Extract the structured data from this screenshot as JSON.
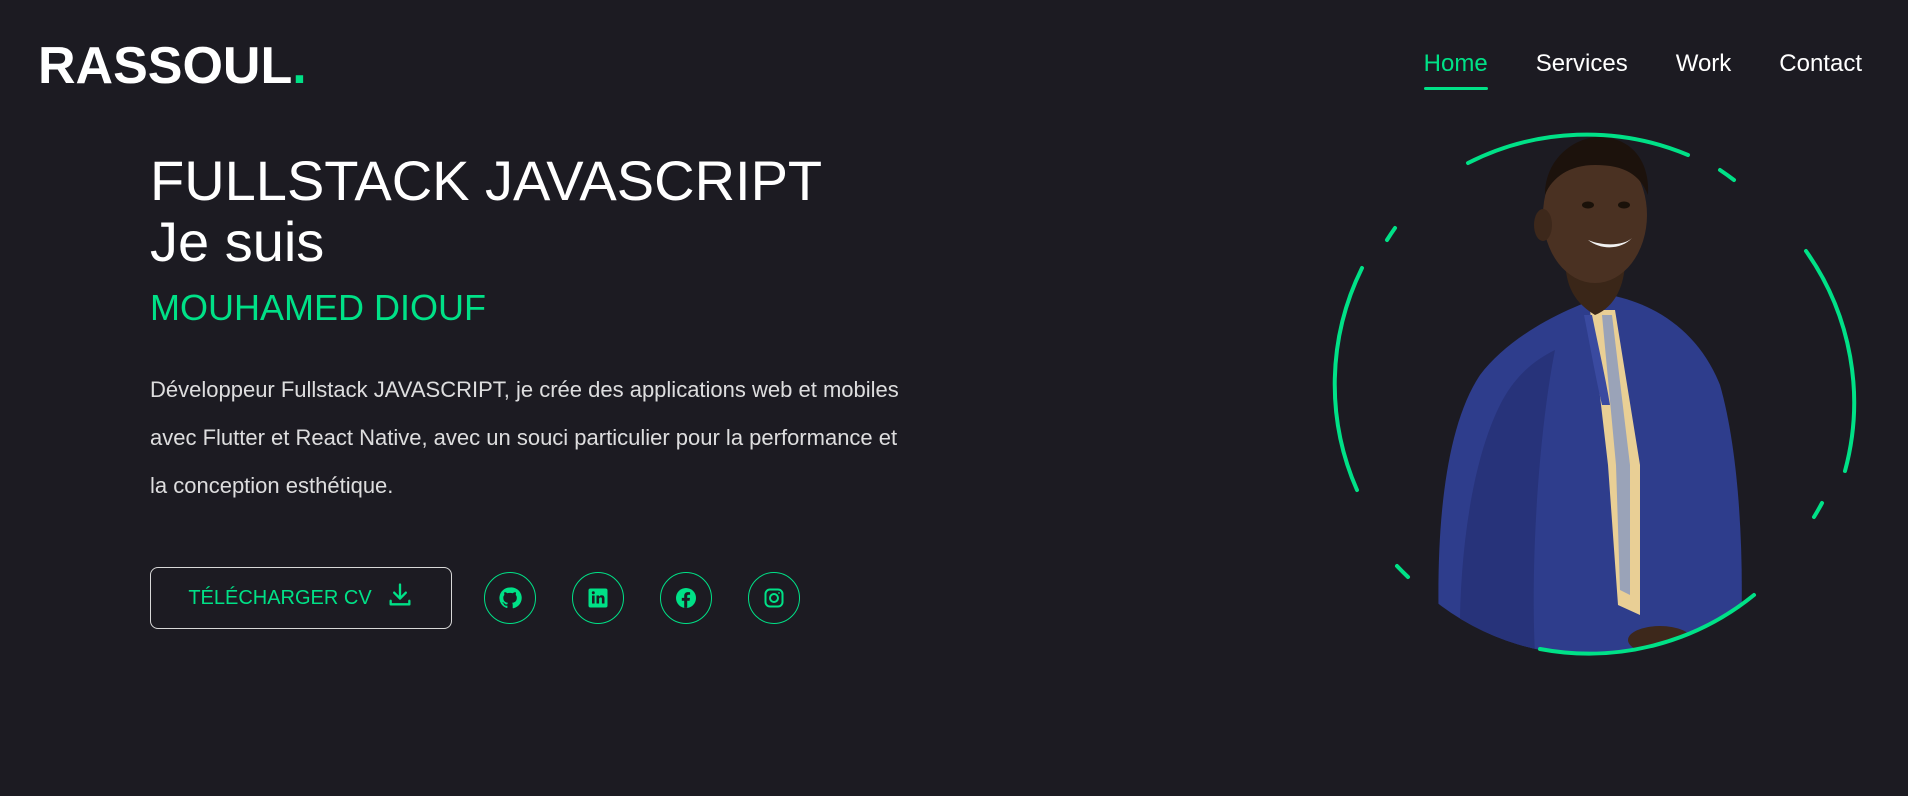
{
  "header": {
    "logo_text": "RASSOUL",
    "logo_dot": ".",
    "nav": [
      {
        "label": "Home",
        "active": true
      },
      {
        "label": "Services",
        "active": false
      },
      {
        "label": "Work",
        "active": false
      },
      {
        "label": "Contact",
        "active": false
      }
    ]
  },
  "hero": {
    "role": "FULLSTACK JAVASCRIPT",
    "intro": "Je suis",
    "name": "MOUHAMED DIOUF",
    "bio": "Développeur Fullstack JAVASCRIPT, je crée des applications web et mobiles avec Flutter et React Native, avec un souci particulier pour la performance et la conception esthétique.",
    "cv_button_label": "TÉLÉCHARGER CV",
    "cv_button_icon": "download-icon",
    "socials": [
      {
        "name": "github-icon"
      },
      {
        "name": "linkedin-icon"
      },
      {
        "name": "facebook-icon"
      },
      {
        "name": "instagram-icon"
      }
    ]
  },
  "colors": {
    "background": "#1c1b22",
    "accent": "#00e187",
    "text": "#ffffff"
  }
}
